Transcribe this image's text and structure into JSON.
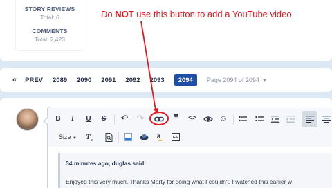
{
  "stats": {
    "story_reviews_label": "STORY REVIEWS",
    "story_reviews_total": "Total: 6",
    "comments_label": "COMMENTS",
    "comments_total": "Total: 2,423"
  },
  "annotation": {
    "before": "Do ",
    "emphasis": "NOT",
    "after": " use this button to add a YouTube video",
    "color": "#e8151b"
  },
  "pagination": {
    "first": "«",
    "prev": "PREV",
    "pages": [
      "2089",
      "2090",
      "2091",
      "2092",
      "2093"
    ],
    "current": "2094",
    "info": "Page 2094 of 2094",
    "caret": "▼"
  },
  "toolbar": {
    "bold": "B",
    "italic": "I",
    "underline": "U",
    "strikethrough": "S",
    "undo": "↶",
    "redo": "↷",
    "link_icon": "link-icon",
    "quote": "99",
    "code": "<>",
    "preview": "eye-icon",
    "emoji": "☺",
    "size_label": "Size",
    "size_caret": "▼",
    "clear_format": "T",
    "clear_format_sub": "x"
  },
  "quote": {
    "author_line": "34 minutes ago, duglas said:",
    "text": "Enjoyed this very much. Thanks Marty for doing what I couldn't. I watched this earlier w"
  }
}
